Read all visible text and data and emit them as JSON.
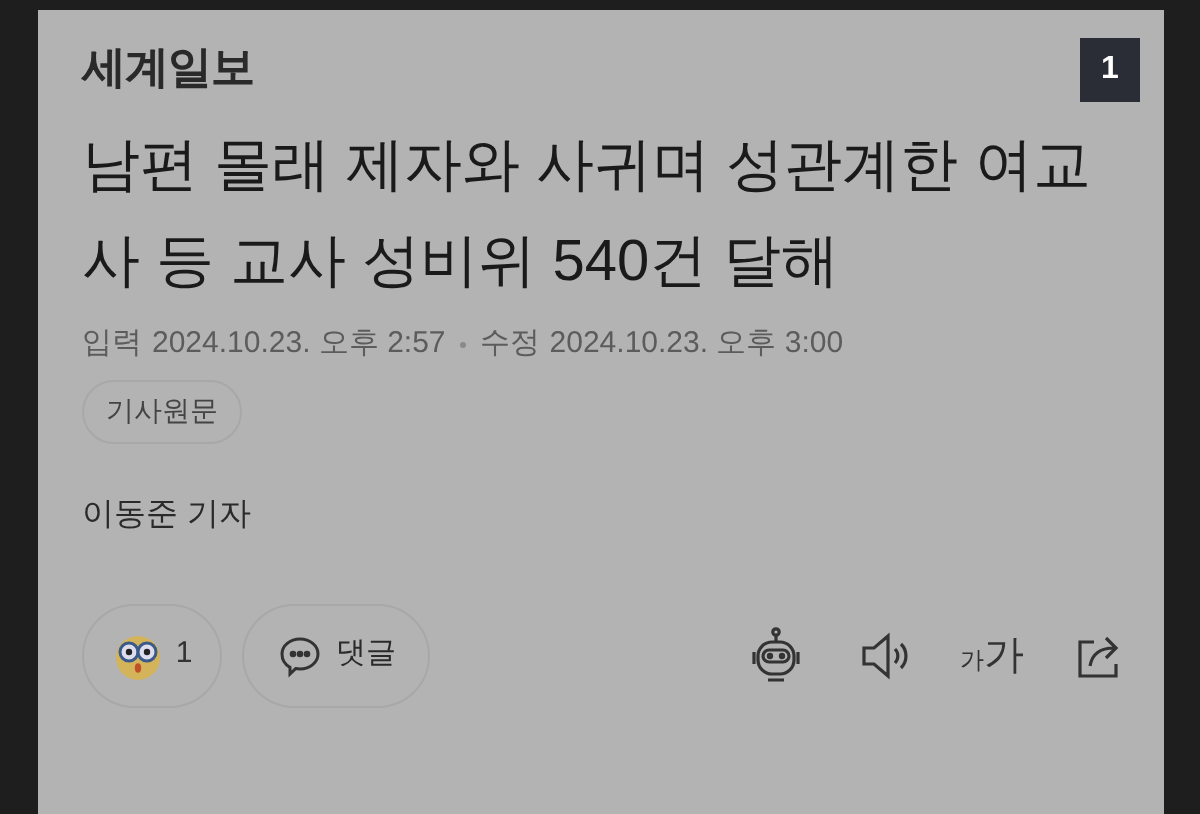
{
  "logo": "세계일보",
  "page_badge": "1",
  "headline": "남편 몰래 제자와 사귀며 성관계한 여교사 등 교사 성비위 540건 달해",
  "meta": {
    "input_label": "입력",
    "input_time": "2024.10.23. 오후 2:57",
    "edit_label": "수정",
    "edit_time": "2024.10.23. 오후 3:00"
  },
  "original_link": "기사원문",
  "byline": "이동준 기자",
  "reaction": {
    "count": "1"
  },
  "comment_button": "댓글",
  "font_size": {
    "small": "가",
    "large": "가"
  }
}
